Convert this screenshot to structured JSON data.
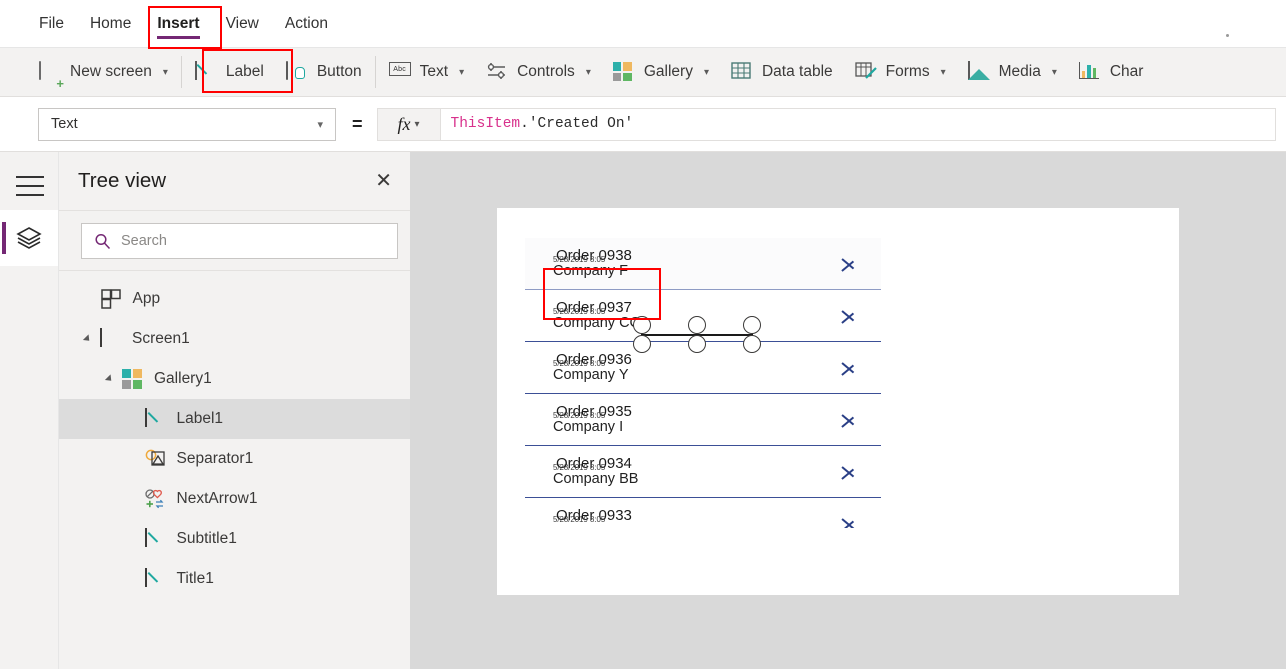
{
  "menubar": {
    "items": [
      {
        "label": "File",
        "active": false
      },
      {
        "label": "Home",
        "active": false
      },
      {
        "label": "Insert",
        "active": true
      },
      {
        "label": "View",
        "active": false
      },
      {
        "label": "Action",
        "active": false
      }
    ],
    "highlight_color": "#ff0000",
    "accent_color": "#742774"
  },
  "ribbon": {
    "items": [
      {
        "label": "New screen",
        "icon": "new-screen-icon",
        "has_chevron": true
      },
      {
        "label": "Label",
        "icon": "label-pencil-icon",
        "has_chevron": false
      },
      {
        "label": "Button",
        "icon": "button-icon",
        "has_chevron": false
      },
      {
        "label": "Text",
        "icon": "text-abc-icon",
        "has_chevron": true
      },
      {
        "label": "Controls",
        "icon": "controls-sliders-icon",
        "has_chevron": true
      },
      {
        "label": "Gallery",
        "icon": "gallery-grid-icon",
        "has_chevron": true
      },
      {
        "label": "Data table",
        "icon": "data-table-icon",
        "has_chevron": false
      },
      {
        "label": "Forms",
        "icon": "forms-icon",
        "has_chevron": true
      },
      {
        "label": "Media",
        "icon": "media-image-icon",
        "has_chevron": true
      },
      {
        "label": "Char",
        "icon": "chart-bars-icon",
        "has_chevron": false
      }
    ]
  },
  "formula_bar": {
    "property_value": "Text",
    "equals": "=",
    "fx_label": "fx",
    "formula_object": "ThisItem",
    "formula_rest": ".'Created On'"
  },
  "tree_view": {
    "title": "Tree view",
    "close_label": "✕",
    "search_placeholder": "Search",
    "search_value": "",
    "nodes": [
      {
        "label": "App",
        "icon": "app-icon",
        "depth": 0,
        "expander": "none",
        "selected": false
      },
      {
        "label": "Screen1",
        "icon": "screen-icon",
        "depth": 0,
        "expander": "expanded",
        "selected": false
      },
      {
        "label": "Gallery1",
        "icon": "gallery-icon",
        "depth": 1,
        "expander": "expanded",
        "selected": false
      },
      {
        "label": "Label1",
        "icon": "label-icon",
        "depth": 2,
        "expander": "none",
        "selected": true
      },
      {
        "label": "Separator1",
        "icon": "separator-icon",
        "depth": 2,
        "expander": "none",
        "selected": false
      },
      {
        "label": "NextArrow1",
        "icon": "next-arrow-icon",
        "depth": 2,
        "expander": "none",
        "selected": false
      },
      {
        "label": "Subtitle1",
        "icon": "label-icon",
        "depth": 2,
        "expander": "none",
        "selected": false
      },
      {
        "label": "Title1",
        "icon": "label-icon",
        "depth": 2,
        "expander": "none",
        "selected": false
      }
    ]
  },
  "canvas": {
    "gallery_rows": [
      {
        "title": "Order 0938",
        "date": "5/28/2019 8:05",
        "subtitle": "Company F",
        "selected": true
      },
      {
        "title": "Order 0937",
        "date": "5/28/2019 8:05",
        "subtitle": "Company CC",
        "selected": false
      },
      {
        "title": "Order 0936",
        "date": "5/28/2019 8:05",
        "subtitle": "Company Y",
        "selected": false
      },
      {
        "title": "Order 0935",
        "date": "5/28/2019 8:05",
        "subtitle": "Company I",
        "selected": false
      },
      {
        "title": "Order 0934",
        "date": "5/28/2019 8:05",
        "subtitle": "Company BB",
        "selected": false
      },
      {
        "title": "Order 0933",
        "date": "5/28/2019 8:05",
        "subtitle": "",
        "selected": false
      }
    ],
    "chevron_color": "#2a3f86",
    "separator_color": "#3b4f96"
  },
  "rail": {
    "hamburger_name": "hamburger-menu",
    "layers_name": "layers-panel"
  }
}
